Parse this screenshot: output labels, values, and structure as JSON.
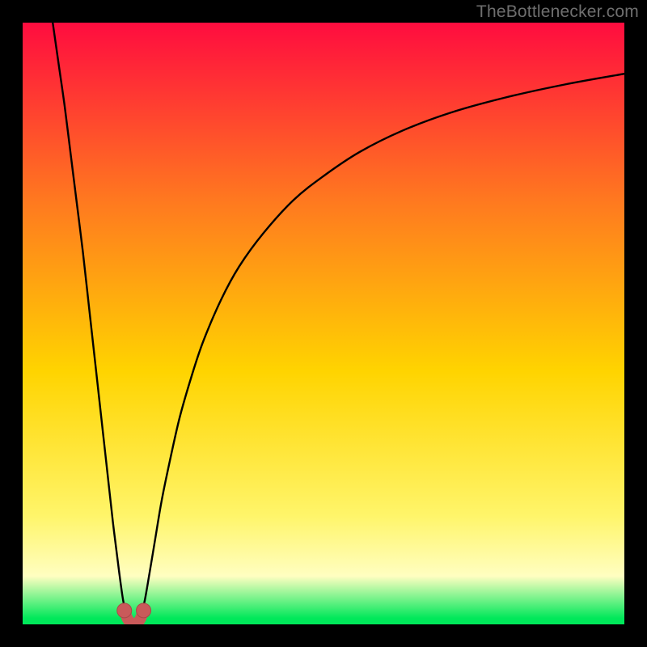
{
  "watermark": "TheBottlenecker.com",
  "colors": {
    "frame": "#000000",
    "gradient_top": "#ff0c3f",
    "gradient_mid_upper": "#ff7a1f",
    "gradient_mid": "#ffd400",
    "gradient_lower": "#fff56a",
    "gradient_band": "#fffec1",
    "gradient_bottom": "#00e85a",
    "curve": "#000000",
    "marker": "#c95a5a",
    "marker_stroke": "#aa4848"
  },
  "chart_data": {
    "type": "line",
    "title": "",
    "xlabel": "",
    "ylabel": "",
    "xlim": [
      0,
      100
    ],
    "ylim": [
      0,
      100
    ],
    "minimum_x": 18.5,
    "series": [
      {
        "name": "left-branch",
        "x": [
          5,
          6,
          7,
          8,
          9,
          10,
          11,
          12,
          13,
          14,
          15,
          16,
          16.7,
          17.3
        ],
        "y": [
          100,
          93,
          86,
          78,
          70,
          62,
          53,
          44,
          35,
          26,
          17,
          9,
          4,
          1.5
        ]
      },
      {
        "name": "right-branch",
        "x": [
          19.7,
          20.3,
          21,
          22,
          23,
          24,
          26,
          28,
          30,
          33,
          36,
          40,
          45,
          50,
          56,
          63,
          71,
          80,
          90,
          100
        ],
        "y": [
          1.5,
          4,
          8,
          14,
          20,
          25,
          34,
          41,
          47,
          54,
          59.5,
          65,
          70.5,
          74.5,
          78.5,
          82,
          85,
          87.5,
          89.7,
          91.5
        ]
      }
    ],
    "markers": {
      "name": "bottom-u",
      "x": [
        16.9,
        17.4,
        17.9,
        18.5,
        19.1,
        19.6,
        20.1
      ],
      "y": [
        2.3,
        1.0,
        0.3,
        0.1,
        0.3,
        1.0,
        2.3
      ]
    }
  }
}
